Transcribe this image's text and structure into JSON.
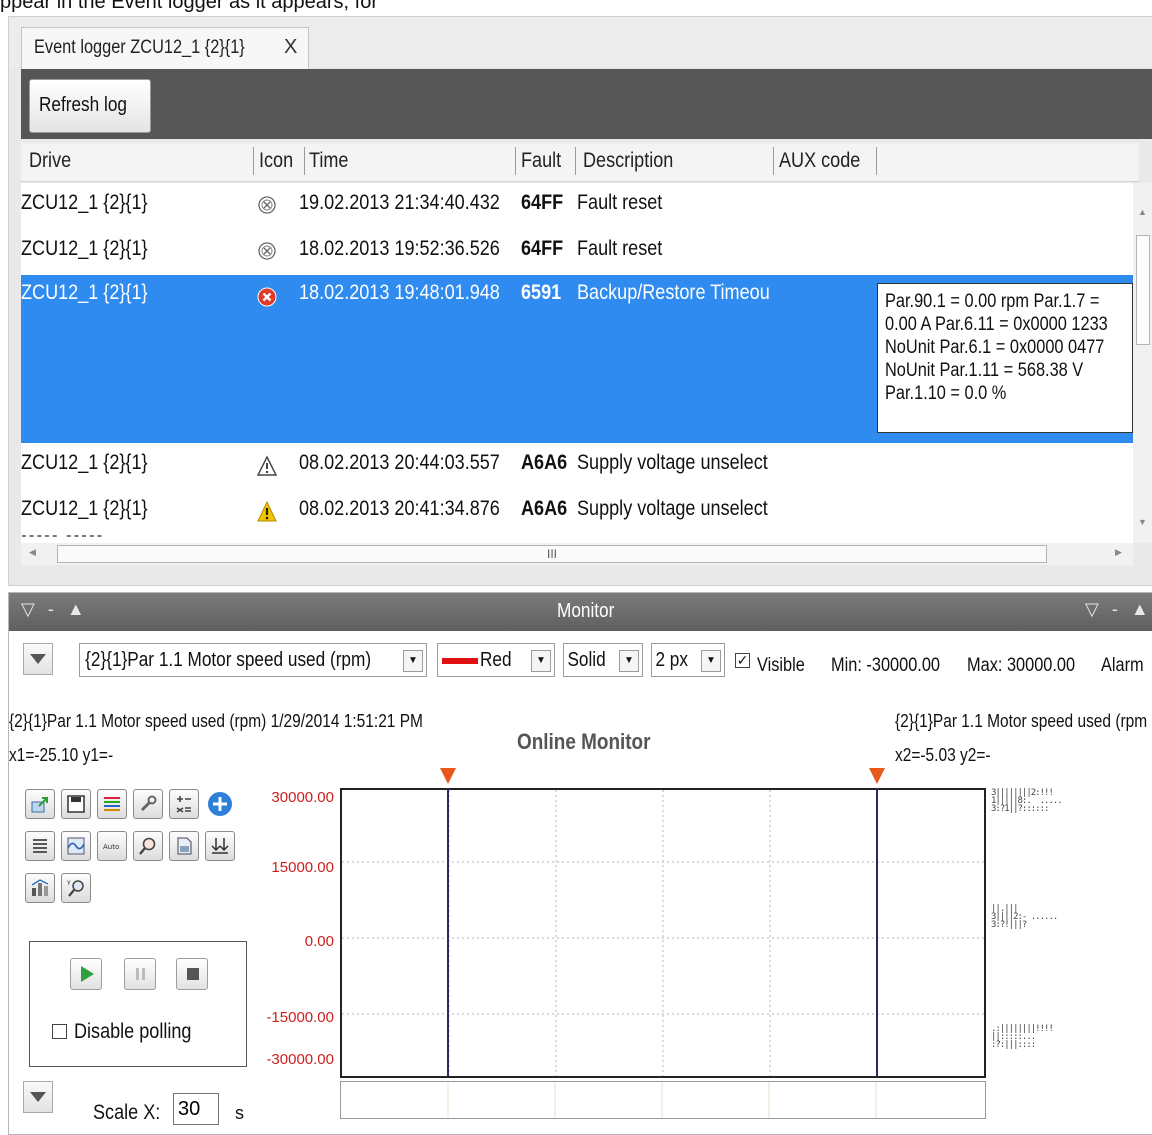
{
  "top_caption": "ppear in the Event logger as it appears, for",
  "logger": {
    "tab_title": "Event logger ZCU12_1 {2}{1}",
    "tab_close": "X",
    "refresh_button": "Refresh log",
    "columns": [
      "Drive",
      "Icon",
      "Time",
      "Fault",
      "Description",
      "AUX code"
    ],
    "rows": [
      {
        "drive": "ZCU12_1 {2}{1}",
        "icon": "fault-reset-icon",
        "time": "19.02.2013 21:34:40.432",
        "fault": "64FF",
        "description": "Fault reset",
        "selected": false
      },
      {
        "drive": "ZCU12_1 {2}{1}",
        "icon": "fault-reset-icon",
        "time": "18.02.2013 19:52:36.526",
        "fault": "64FF",
        "description": "Fault reset",
        "selected": false
      },
      {
        "drive": "ZCU12_1 {2}{1}",
        "icon": "fault-icon",
        "time": "18.02.2013 19:48:01.948",
        "fault": "6591",
        "description": "Backup/Restore Timeou",
        "selected": true
      },
      {
        "drive": "ZCU12_1 {2}{1}",
        "icon": "warning-outline-icon",
        "time": "08.02.2013 20:44:03.557",
        "fault": "A6A6",
        "description": "Supply voltage unselect",
        "selected": false
      },
      {
        "drive": "ZCU12_1 {2}{1}",
        "icon": "warning-icon",
        "time": "08.02.2013 20:41:34.876",
        "fault": "A6A6",
        "description": "Supply voltage unselect",
        "selected": false
      }
    ],
    "aux_lines": [
      "Par.90.1 = 0.00 rpm Par.1.7 =",
      "0.00 A Par.6.11 = 0x0000 1233",
      "NoUnit Par.6.1 = 0x0000 0477",
      "NoUnit Par.1.11 = 568.38 V",
      "Par.1.10 = 0.0 %"
    ],
    "hscroll_grip": "III"
  },
  "monitor": {
    "title": "Monitor",
    "signal_select": "{2}{1}Par 1.1 Motor speed used (rpm)",
    "color_select": "Red",
    "line_color": "#e01010",
    "style_select": "Solid",
    "width_select": "2 px",
    "visible_label": "Visible",
    "visible_checked": true,
    "min_label": "Min: -30000.00",
    "max_label": "Max: 30000.00",
    "alarm_label": "Alarm",
    "info_left": "{2}{1}Par 1.1 Motor speed used (rpm) 1/29/2014 1:51:21 PM",
    "cursor1": "x1=-25.10 y1=-",
    "chart_title": "Online Monitor",
    "info_right": "{2}{1}Par 1.1 Motor speed used (rpm",
    "cursor2": "x2=-5.03 y2=-",
    "disable_polling_label": "Disable polling",
    "disable_polling_checked": false,
    "scale_x_label": "Scale X:",
    "scale_x_value": "30",
    "scale_x_unit": "s"
  },
  "chart_data": {
    "type": "line",
    "title": "Online Monitor",
    "y_ticks": [
      "30000.00",
      "15000.00",
      "0.00",
      "-15000.00",
      "-30000.00"
    ],
    "ylim": [
      -30000,
      30000
    ],
    "tick_color": "#cc1e1e",
    "cursors": {
      "x1": -25.1,
      "x2": -5.03
    },
    "grid": true,
    "series": []
  }
}
